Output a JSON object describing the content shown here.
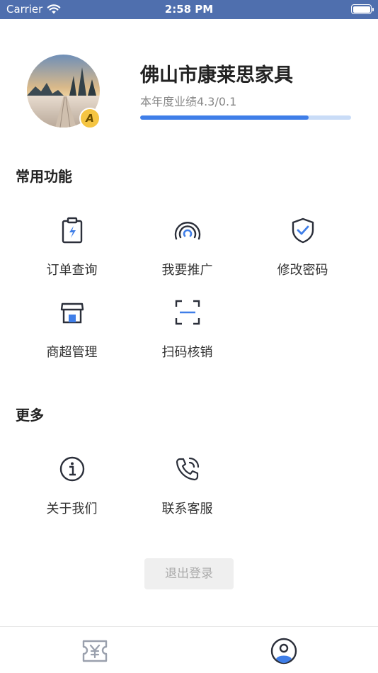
{
  "status_bar": {
    "carrier": "Carrier",
    "time": "2:58 PM"
  },
  "profile": {
    "shop_name": "佛山市康莱思家具",
    "performance_label": "本年度业绩4.3/0.1",
    "progress_fraction": 0.8,
    "level_badge": "A"
  },
  "common_functions": {
    "title": "常用功能",
    "items": [
      {
        "label": "订单查询",
        "icon": "clipboard-bolt-icon"
      },
      {
        "label": "我要推广",
        "icon": "broadcast-icon"
      },
      {
        "label": "修改密码",
        "icon": "shield-check-icon"
      },
      {
        "label": "商超管理",
        "icon": "store-icon"
      },
      {
        "label": "扫码核销",
        "icon": "scan-icon"
      }
    ]
  },
  "more": {
    "title": "更多",
    "items": [
      {
        "label": "关于我们",
        "icon": "info-icon"
      },
      {
        "label": "联系客服",
        "icon": "phone-call-icon"
      }
    ]
  },
  "logout_label": "退出登录",
  "tab_bar": {
    "tabs": [
      {
        "icon": "yen-ticket-icon",
        "active": false
      },
      {
        "icon": "user-circle-icon",
        "active": true
      }
    ]
  },
  "colors": {
    "status_bar": "#4f6fae",
    "accent": "#3f7ee8",
    "progress_track": "#c9dcf7",
    "icon_dark": "#2b2f3a",
    "badge": "#f5c542"
  }
}
